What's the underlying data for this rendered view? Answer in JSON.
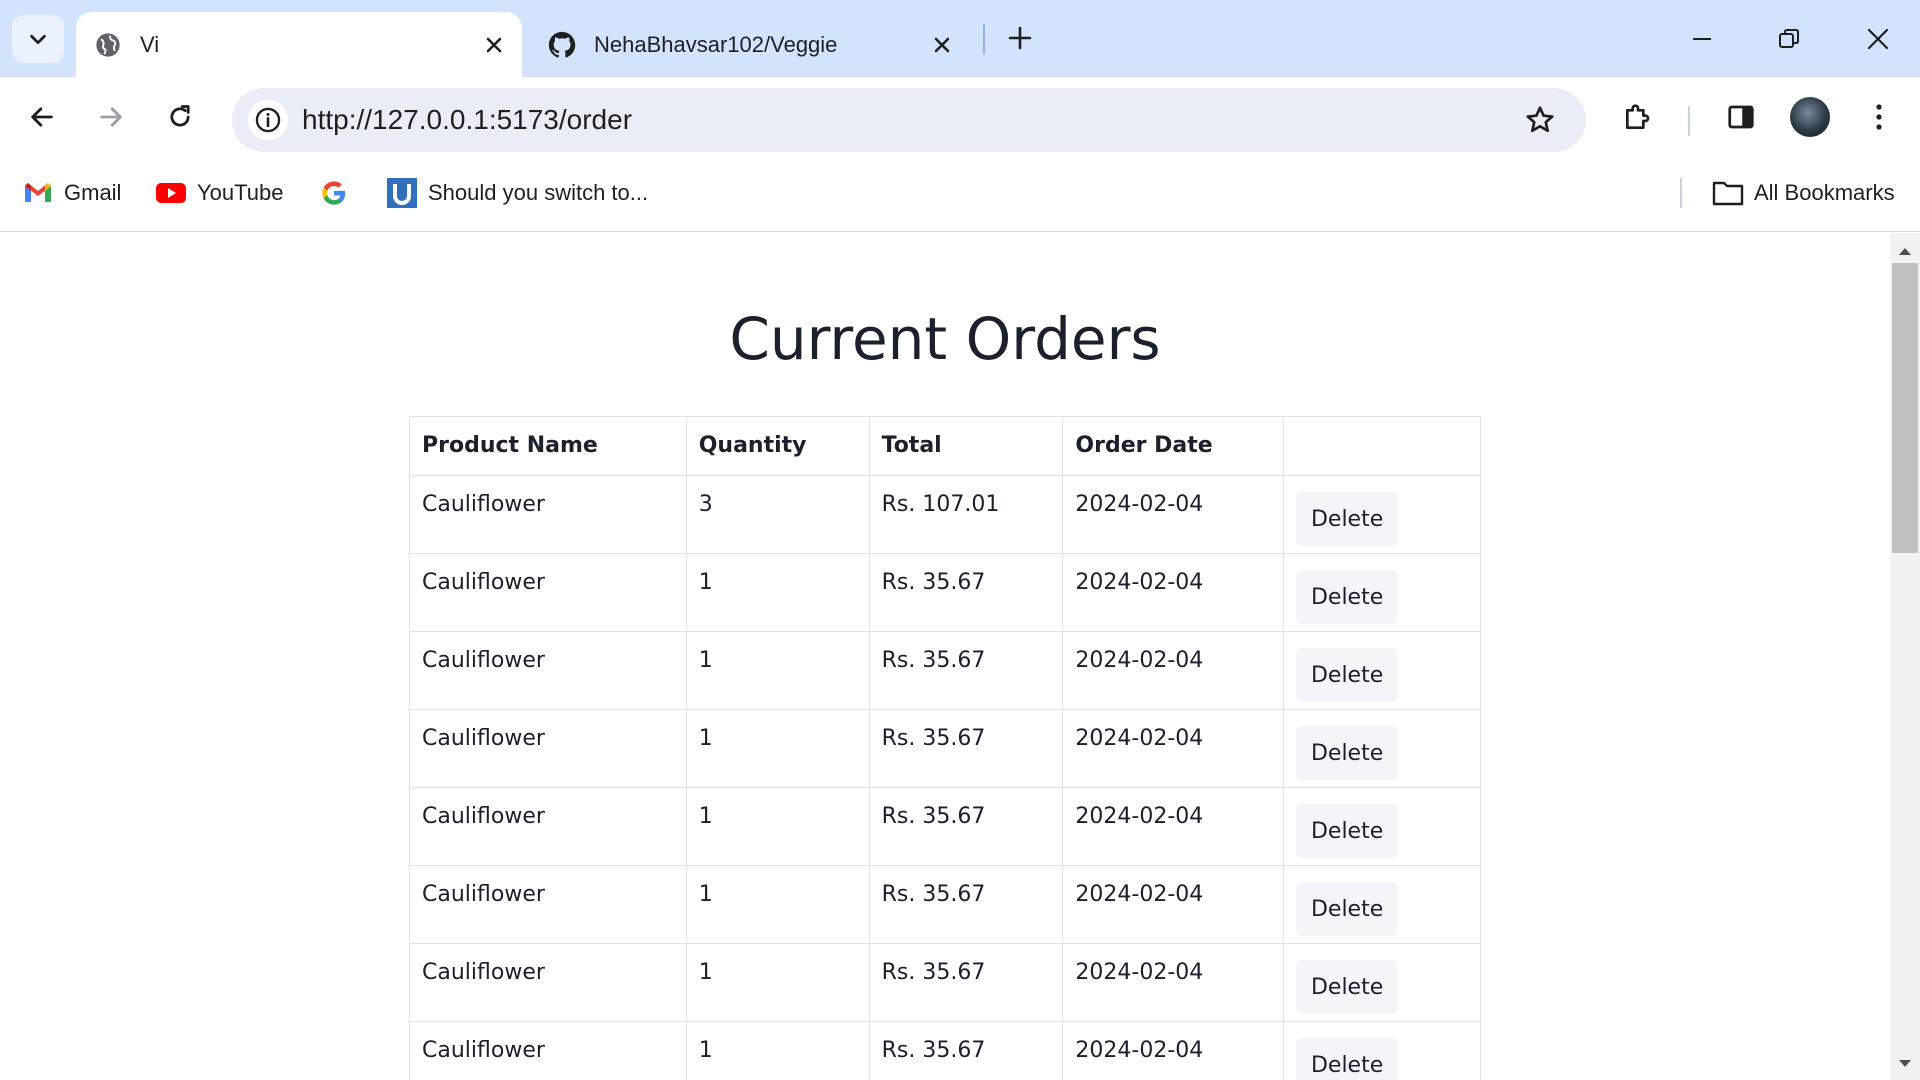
{
  "browser": {
    "tabs": [
      {
        "title": "Vi",
        "favicon": "globe-icon",
        "active": true
      },
      {
        "title": "NehaBhavsar102/Veggie",
        "favicon": "github-icon",
        "active": false
      }
    ],
    "url": "http://127.0.0.1:5173/order",
    "bookmarks": [
      {
        "label": "Gmail",
        "icon": "gmail-icon"
      },
      {
        "label": "YouTube",
        "icon": "youtube-icon"
      },
      {
        "label": "",
        "icon": "google-icon"
      },
      {
        "label": "Should you switch to...",
        "icon": "u-icon"
      }
    ],
    "all_bookmarks_label": "All Bookmarks",
    "colors": {
      "tabstrip": "#d3e3fd",
      "omnibox": "#e9eef6"
    }
  },
  "page": {
    "title": "Current Orders",
    "columns": [
      "Product Name",
      "Quantity",
      "Total",
      "Order Date",
      ""
    ],
    "delete_label": "Delete",
    "rows": [
      {
        "product": "Cauliflower",
        "quantity": "3",
        "total": "Rs. 107.01",
        "date": "2024-02-04"
      },
      {
        "product": "Cauliflower",
        "quantity": "1",
        "total": "Rs. 35.67",
        "date": "2024-02-04"
      },
      {
        "product": "Cauliflower",
        "quantity": "1",
        "total": "Rs. 35.67",
        "date": "2024-02-04"
      },
      {
        "product": "Cauliflower",
        "quantity": "1",
        "total": "Rs. 35.67",
        "date": "2024-02-04"
      },
      {
        "product": "Cauliflower",
        "quantity": "1",
        "total": "Rs. 35.67",
        "date": "2024-02-04"
      },
      {
        "product": "Cauliflower",
        "quantity": "1",
        "total": "Rs. 35.67",
        "date": "2024-02-04"
      },
      {
        "product": "Cauliflower",
        "quantity": "1",
        "total": "Rs. 35.67",
        "date": "2024-02-04"
      },
      {
        "product": "Cauliflower",
        "quantity": "1",
        "total": "Rs. 35.67",
        "date": "2024-02-04"
      }
    ]
  }
}
